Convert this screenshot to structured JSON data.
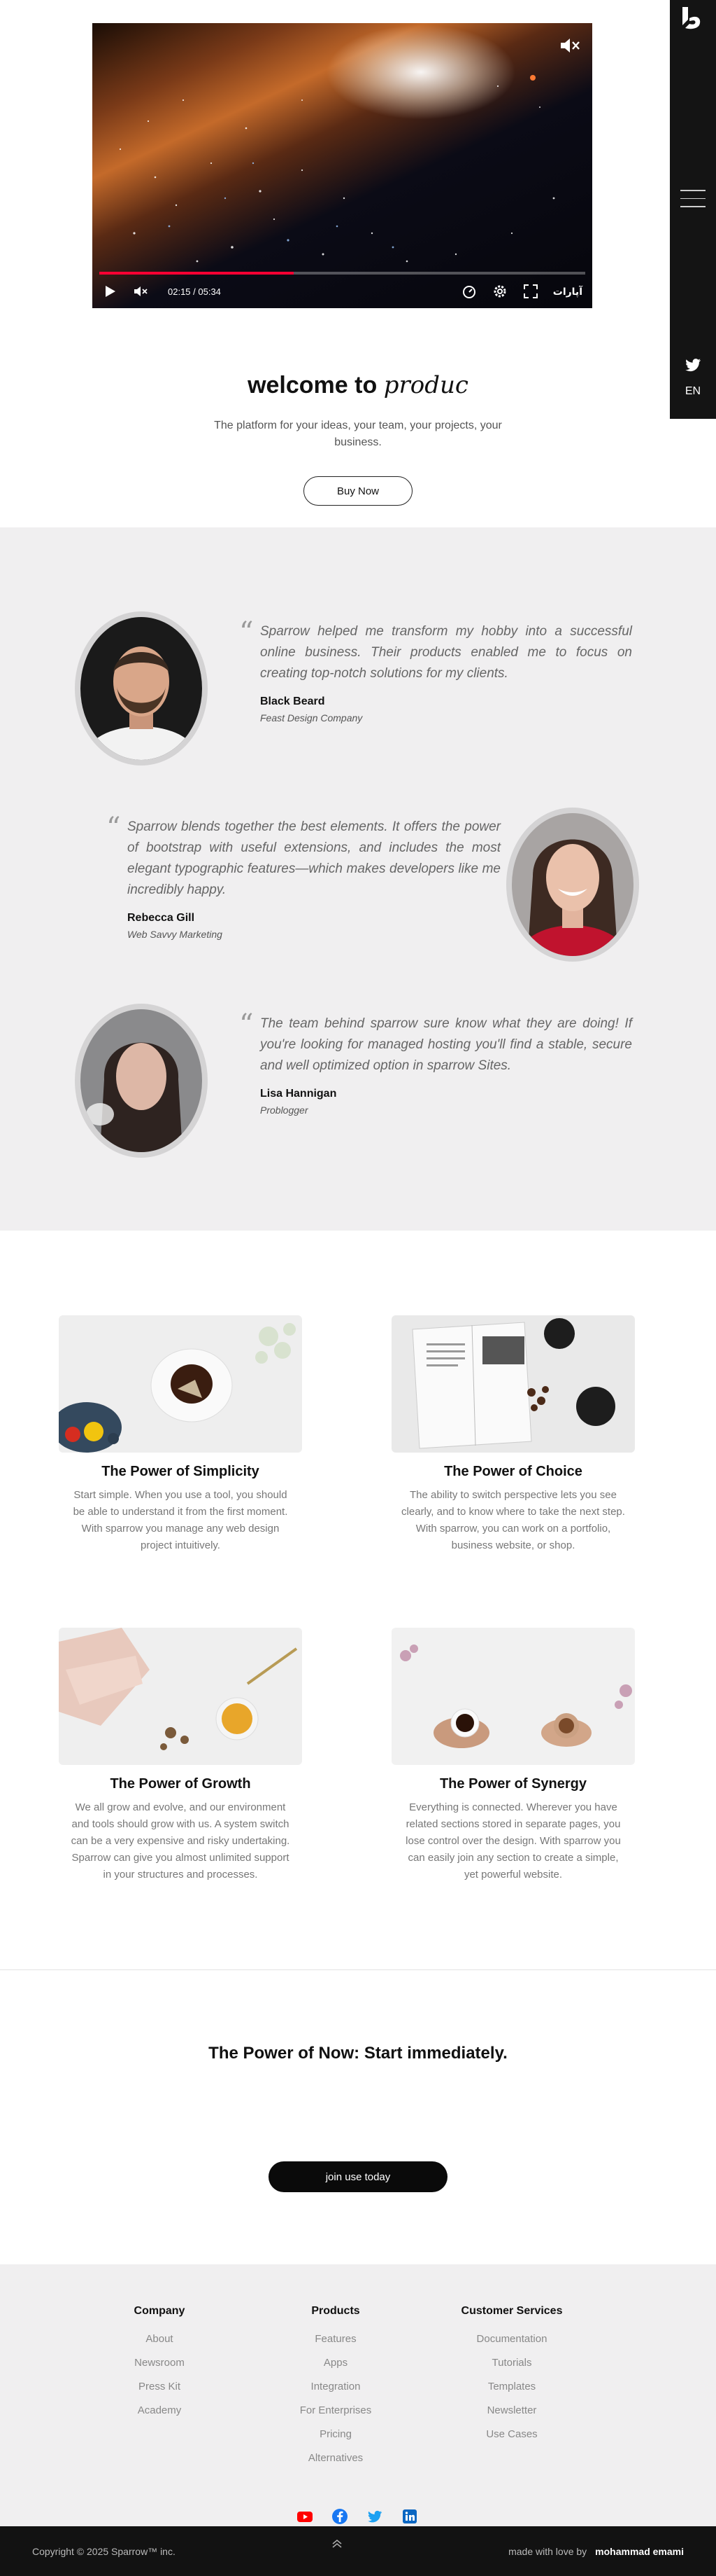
{
  "sidebar": {
    "lang": "EN"
  },
  "video": {
    "time": "02:15 / 05:34",
    "brand": "آپارات",
    "progress": 0.4
  },
  "hero": {
    "title_bold": "welcome to",
    "title_italic": "produc",
    "subtitle": "The platform for your ideas, your team, your projects, your business.",
    "cta": "Buy Now"
  },
  "testimonials": [
    {
      "quote": "Sparrow helped me transform my hobby into a successful online business. Their products enabled me to focus on creating top-notch solutions for my clients.",
      "name": "Black Beard",
      "company": "Feast Design Company"
    },
    {
      "quote": "Sparrow blends together the best elements. It offers the power of bootstrap with useful extensions, and includes the most elegant typographic features—which makes developers like me incredibly happy.",
      "name": "Rebecca Gill",
      "company": "Web Savvy Marketing"
    },
    {
      "quote": "The team behind sparrow sure know what they are doing! If you're looking for managed hosting you'll find a stable, secure and well optimized option in sparrow Sites.",
      "name": "Lisa Hannigan",
      "company": "Problogger"
    }
  ],
  "features": [
    {
      "title": "The Power of Simplicity",
      "text": "Start simple. When you use a tool, you should be able to understand it from the first moment. With sparrow you manage any web design project intuitively."
    },
    {
      "title": "The Power of Choice",
      "text": "The ability to switch perspective lets you see clearly, and to know where to take the next step. With sparrow, you can work on a portfolio, business website, or shop."
    },
    {
      "title": "The Power of Growth",
      "text": "We all grow and evolve, and our environment and tools should grow with us. A system switch can be a very expensive and risky undertaking. Sparrow can give you almost unlimited support in your structures and processes."
    },
    {
      "title": "The Power of Synergy",
      "text": "Everything is connected. Wherever you have related sections stored in separate pages, you lose control over the design. With sparrow you can easily join any section to create a simple, yet powerful website."
    }
  ],
  "cta": {
    "title": "The Power of Now: Start immediately.",
    "button": "join use today"
  },
  "footer": {
    "columns": [
      {
        "title": "Company",
        "links": [
          "About",
          "Newsroom",
          "Press Kit",
          "Academy"
        ]
      },
      {
        "title": "Products",
        "links": [
          "Features",
          "Apps",
          "Integration",
          "For Enterprises",
          "Pricing",
          "Alternatives"
        ]
      },
      {
        "title": "Customer Services",
        "links": [
          "Documentation",
          "Tutorials",
          "Templates",
          "Newsletter",
          "Use Cases"
        ]
      }
    ],
    "copyright": "Copyright © 2025 Sparrow™ inc.",
    "made_with": "made with love by",
    "author": "mohammad emami"
  },
  "colors": {
    "youtube": "#ff0000",
    "facebook": "#1877f2",
    "twitter": "#1da1f2",
    "linkedin": "#0a66c2",
    "progress": "#ff0033"
  },
  "icons": [
    "sparrow-logo-icon",
    "hamburger-menu-icon",
    "twitter-icon",
    "mute-icon",
    "play-icon",
    "volume-icon",
    "speed-icon",
    "settings-icon",
    "fullscreen-icon",
    "youtube-icon",
    "facebook-icon",
    "linkedin-icon",
    "scroll-up-icon",
    "quote-icon"
  ]
}
